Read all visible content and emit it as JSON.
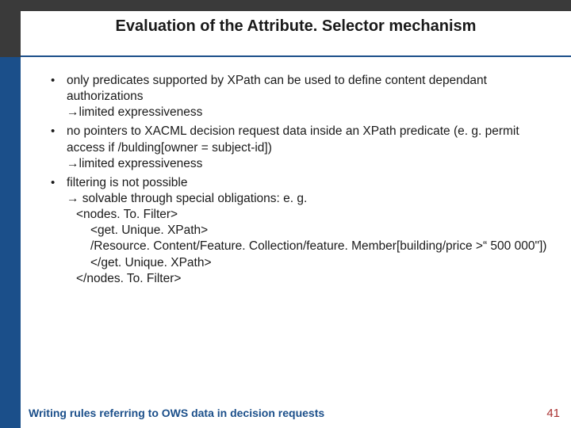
{
  "title": "Evaluation of the Attribute. Selector mechanism",
  "bullets": {
    "b1": {
      "text": "only predicates supported by XPath can be used to define content dependant authorizations",
      "arrow": "→limited expressiveness"
    },
    "b2": {
      "text": "no pointers to XACML decision request data inside an XPath predicate (e. g. permit access if /bulding[owner = subject-id])",
      "arrow": "→limited expressiveness"
    },
    "b3": {
      "text": "filtering is not possible",
      "arrow": "→ solvable through special obligations: e. g.",
      "code": {
        "l1": "<nodes. To. Filter>",
        "l2": "<get. Unique. XPath>",
        "l3": "/Resource. Content/Feature. Collection/feature. Member[building/price >“ 500 000\"])",
        "l4": "</get. Unique. XPath>",
        "l5": "</nodes. To. Filter>"
      }
    }
  },
  "footer": {
    "text": "Writing rules referring to OWS data in decision requests",
    "page": "41"
  }
}
